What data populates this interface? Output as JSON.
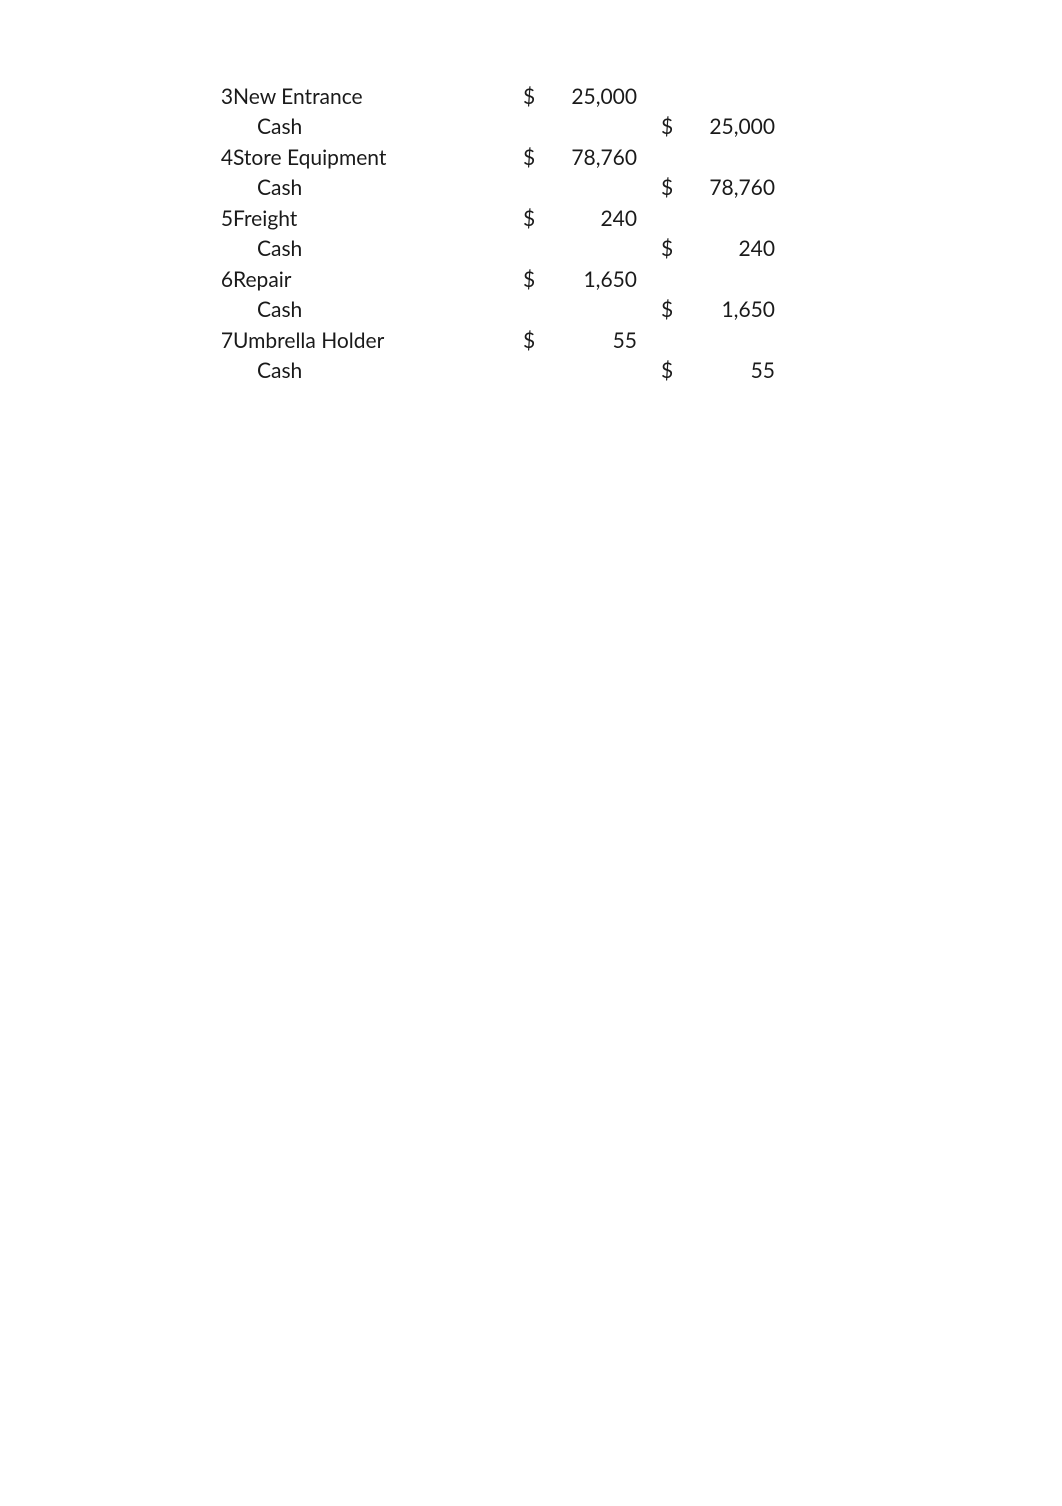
{
  "currency_symbol": "$",
  "entries": [
    {
      "number": "3",
      "debit_account": "New Entrance",
      "debit_amount": "25,000",
      "credit_account": "Cash",
      "credit_amount": "25,000"
    },
    {
      "number": "4",
      "debit_account": "Store Equipment",
      "debit_amount": "78,760",
      "credit_account": "Cash",
      "credit_amount": "78,760"
    },
    {
      "number": "5",
      "debit_account": "Freight",
      "debit_amount": "240",
      "credit_account": "Cash",
      "credit_amount": "240"
    },
    {
      "number": "6",
      "debit_account": "Repair",
      "debit_amount": "1,650",
      "credit_account": "Cash",
      "credit_amount": "1,650"
    },
    {
      "number": "7",
      "debit_account": "Umbrella Holder",
      "debit_amount": "55",
      "credit_account": "Cash",
      "credit_amount": "55"
    }
  ]
}
